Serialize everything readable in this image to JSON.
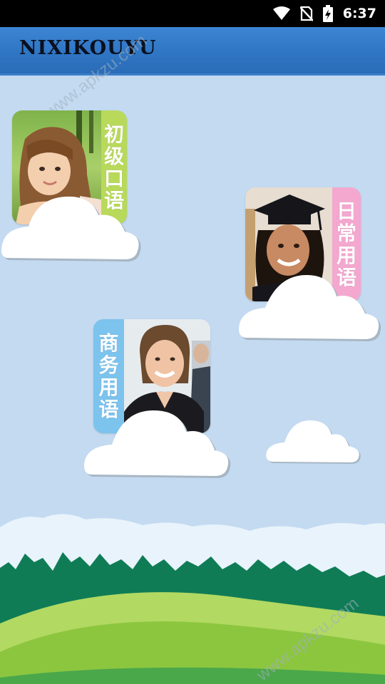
{
  "status_bar": {
    "time": "6:37",
    "icons": [
      "wifi-icon",
      "no-sim-icon",
      "battery-charging-icon"
    ]
  },
  "header": {
    "title": "NIXIKOUYU"
  },
  "watermark": {
    "text": "www.apkzu.com"
  },
  "cards": [
    {
      "id": "beginner",
      "label_chars": [
        "初",
        "级",
        "口",
        "语"
      ],
      "color": "#b8d95a"
    },
    {
      "id": "daily",
      "label_chars": [
        "日",
        "常",
        "用",
        "语"
      ],
      "color": "#f4a7cf"
    },
    {
      "id": "business",
      "label_chars": [
        "商",
        "务",
        "用",
        "语"
      ],
      "color": "#7cc3ee"
    }
  ],
  "colors": {
    "sky": "#c3daf1",
    "header": "#2f76c4",
    "hills_dark": "#0f7c56",
    "hills_light": "#8cc63f"
  }
}
